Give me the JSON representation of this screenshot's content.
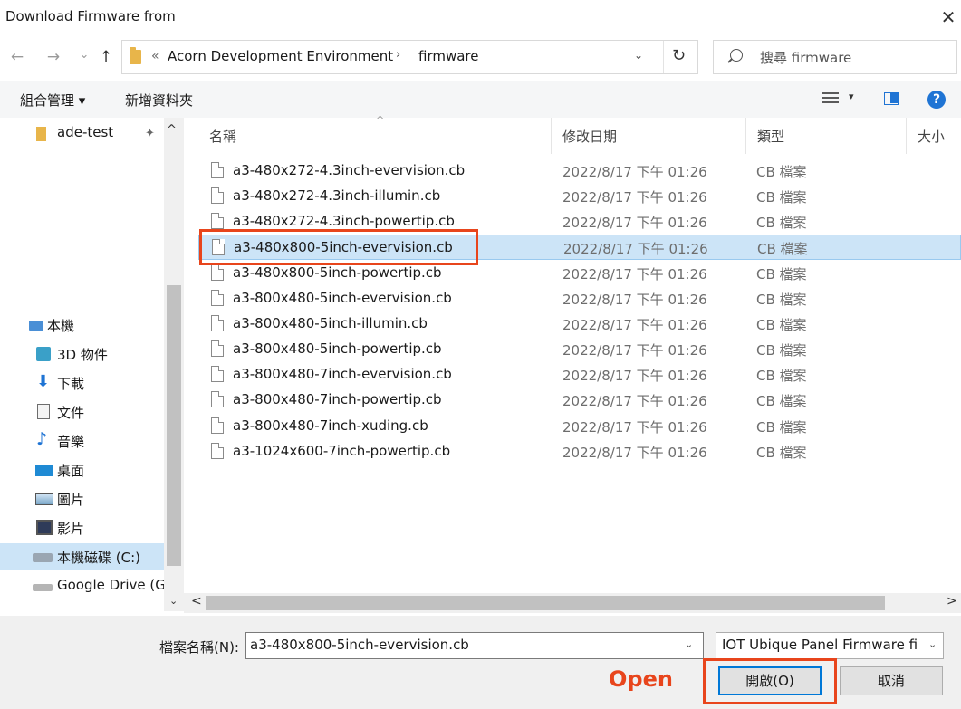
{
  "window": {
    "title": "Download Firmware from",
    "close_glyph": "✕"
  },
  "nav_buttons": {
    "back": "←",
    "forward": "→",
    "recent": "⌄",
    "up": "↑"
  },
  "address": {
    "more": "«",
    "crumbs": [
      "Acorn Development Environment",
      "firmware"
    ],
    "separator": "›",
    "dropdown": "⌄",
    "refresh": "↻"
  },
  "search": {
    "placeholder": "搜尋 firmware"
  },
  "toolbar": {
    "organize_label": "組合管理 ▾",
    "new_folder_label": "新增資料夾",
    "view_drop": "▾",
    "help": "?"
  },
  "nav_pane": {
    "items": [
      {
        "label": "ade-test",
        "icon": "folder-icon"
      },
      {
        "label": "本機",
        "icon": "computer-icon"
      },
      {
        "label": "3D 物件",
        "icon": "3d-objects-icon"
      },
      {
        "label": "下載",
        "icon": "download-icon"
      },
      {
        "label": "文件",
        "icon": "documents-icon"
      },
      {
        "label": "音樂",
        "icon": "music-icon"
      },
      {
        "label": "桌面",
        "icon": "desktop-icon"
      },
      {
        "label": "圖片",
        "icon": "pictures-icon"
      },
      {
        "label": "影片",
        "icon": "videos-icon"
      },
      {
        "label": "本機磁碟 (C:)",
        "icon": "drive-icon"
      },
      {
        "label": "Google Drive (G",
        "icon": "drive-icon"
      }
    ],
    "pin_glyph": "📌",
    "scroll_up": "^",
    "scroll_down": "⌄"
  },
  "columns": {
    "name": "名稱",
    "date": "修改日期",
    "type": "類型",
    "size": "大小",
    "sort_caret": "^"
  },
  "files": [
    {
      "name": "a3-480x272-4.3inch-evervision.cb",
      "date": "2022/8/17 下午 01:26",
      "type": "CB 檔案"
    },
    {
      "name": "a3-480x272-4.3inch-illumin.cb",
      "date": "2022/8/17 下午 01:26",
      "type": "CB 檔案"
    },
    {
      "name": "a3-480x272-4.3inch-powertip.cb",
      "date": "2022/8/17 下午 01:26",
      "type": "CB 檔案"
    },
    {
      "name": "a3-480x800-5inch-evervision.cb",
      "date": "2022/8/17 下午 01:26",
      "type": "CB 檔案",
      "selected": true
    },
    {
      "name": "a3-480x800-5inch-powertip.cb",
      "date": "2022/8/17 下午 01:26",
      "type": "CB 檔案"
    },
    {
      "name": "a3-800x480-5inch-evervision.cb",
      "date": "2022/8/17 下午 01:26",
      "type": "CB 檔案"
    },
    {
      "name": "a3-800x480-5inch-illumin.cb",
      "date": "2022/8/17 下午 01:26",
      "type": "CB 檔案"
    },
    {
      "name": "a3-800x480-5inch-powertip.cb",
      "date": "2022/8/17 下午 01:26",
      "type": "CB 檔案"
    },
    {
      "name": "a3-800x480-7inch-evervision.cb",
      "date": "2022/8/17 下午 01:26",
      "type": "CB 檔案"
    },
    {
      "name": "a3-800x480-7inch-powertip.cb",
      "date": "2022/8/17 下午 01:26",
      "type": "CB 檔案"
    },
    {
      "name": "a3-800x480-7inch-xuding.cb",
      "date": "2022/8/17 下午 01:26",
      "type": "CB 檔案"
    },
    {
      "name": "a3-1024x600-7inch-powertip.cb",
      "date": "2022/8/17 下午 01:26",
      "type": "CB 檔案"
    }
  ],
  "hscroll": {
    "left": "<",
    "right": ">"
  },
  "footer": {
    "filename_label": "檔案名稱(N):",
    "filename_value": "a3-480x800-5inch-evervision.cb",
    "filename_drop": "⌄",
    "filter_value": "IOT Ubique Panel Firmware fi",
    "filter_drop": "⌄",
    "open_label": "開啟(O)",
    "cancel_label": "取消"
  },
  "annotation": {
    "open_text": "Open",
    "color": "#e8451c"
  },
  "colors": {
    "selection": "#cce4f7",
    "accent": "#1f74d4"
  }
}
